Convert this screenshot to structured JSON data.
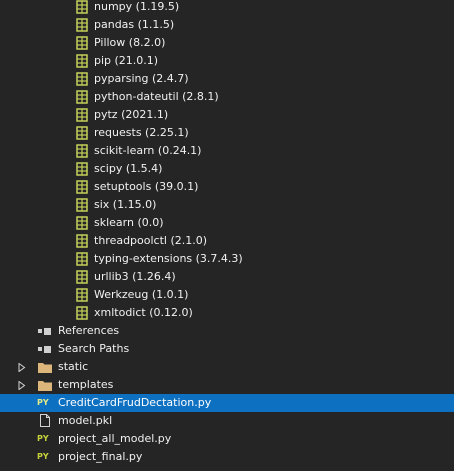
{
  "packages": [
    {
      "label": "numpy (1.19.5)"
    },
    {
      "label": "pandas (1.1.5)"
    },
    {
      "label": "Pillow (8.2.0)"
    },
    {
      "label": "pip (21.0.1)"
    },
    {
      "label": "pyparsing (2.4.7)"
    },
    {
      "label": "python-dateutil (2.8.1)"
    },
    {
      "label": "pytz (2021.1)"
    },
    {
      "label": "requests (2.25.1)"
    },
    {
      "label": "scikit-learn (0.24.1)"
    },
    {
      "label": "scipy (1.5.4)"
    },
    {
      "label": "setuptools (39.0.1)"
    },
    {
      "label": "six (1.15.0)"
    },
    {
      "label": "sklearn (0.0)"
    },
    {
      "label": "threadpoolctl (2.1.0)"
    },
    {
      "label": "typing-extensions (3.7.4.3)"
    },
    {
      "label": "urllib3 (1.26.4)"
    },
    {
      "label": "Werkzeug (1.0.1)"
    },
    {
      "label": "xmltodict (0.12.0)"
    }
  ],
  "references": {
    "label": "References"
  },
  "search_paths": {
    "label": "Search Paths"
  },
  "folders": [
    {
      "label": "static"
    },
    {
      "label": "templates"
    }
  ],
  "files": [
    {
      "label": "CreditCardFrudDectation.py",
      "icon": "PY",
      "selected": true
    },
    {
      "label": "model.pkl",
      "icon": "document"
    },
    {
      "label": "project_all_model.py",
      "icon": "PY"
    },
    {
      "label": "project_final.py",
      "icon": "PY"
    }
  ],
  "colors": {
    "background": "#252526",
    "selection": "#0e70c0",
    "package_icon": "#c5d15a",
    "folder_icon": "#dcb67a",
    "py_icon": "#c6d13a",
    "text": "#f1f1f1"
  }
}
